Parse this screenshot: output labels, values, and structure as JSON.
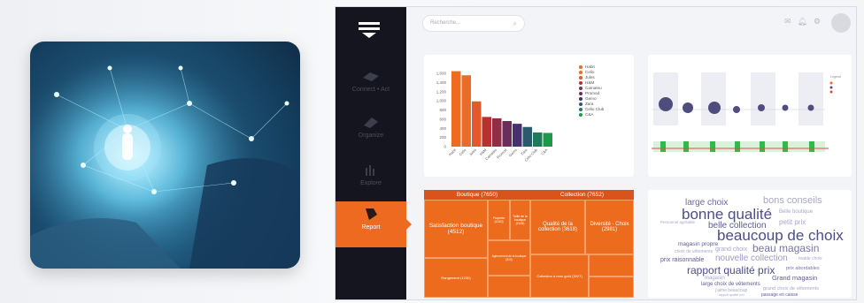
{
  "colors": {
    "accent": "#ee6a20",
    "sidebar": "#15151f",
    "word_dark": "#4a4a8a",
    "word_light": "#9b9bc4"
  },
  "sidebar": {
    "items": [
      {
        "label": "Connect • Act",
        "icon": "connect-icon",
        "active": false
      },
      {
        "label": "Organize",
        "icon": "organize-icon",
        "active": false
      },
      {
        "label": "Explore",
        "icon": "explore-icon",
        "active": false
      },
      {
        "label": "Report",
        "icon": "report-icon",
        "active": true
      }
    ]
  },
  "search": {
    "placeholder": "Recherche..."
  },
  "bar_chart": {
    "chart_data": {
      "type": "bar",
      "categories": [
        "Habit",
        "Celio",
        "Jules",
        "H&M",
        "Camaïeu",
        "Promod",
        "Gemo",
        "Zara",
        "Celio Club",
        "C&A"
      ],
      "values": [
        1650,
        1560,
        990,
        650,
        620,
        560,
        500,
        430,
        310,
        300
      ],
      "ylim": [
        0,
        1700
      ],
      "yticks": [
        "0",
        "200",
        "400",
        "600",
        "800",
        "1,000",
        "1,200",
        "1,400",
        "1,600"
      ],
      "colors": [
        "#ef6b1e",
        "#ec6b25",
        "#e35a28",
        "#b7312f",
        "#8f2e47",
        "#6b2d5c",
        "#47306e",
        "#2b5a6f",
        "#237a5b",
        "#1d9a49"
      ],
      "legend": [
        "Habit",
        "Celio",
        "Jules",
        "H&M",
        "Camaïeu",
        "Promod",
        "Gemo",
        "Zara",
        "Celio Club",
        "C&A"
      ]
    }
  },
  "treemap": {
    "headers": [
      "Boutique (7650)",
      "Collection (7652)"
    ],
    "cells": [
      "Satisfaction boutique (4512)",
      "Proprete (1330)",
      "Taille de la boutique (1105)",
      "Qualité de la collection (3618)",
      "Diversité - Choix (2981)",
      "Rangement (1230)",
      "Agencement de la boutique (813)",
      "Collection à mon goût (2027)"
    ]
  },
  "wordcloud": {
    "words": [
      "large choix",
      "bons conseils",
      "bonne qualité",
      "Belle boutique",
      "belle collection",
      "petit prix",
      "Personnel agréable",
      "beaucoup de choix",
      "magasin propre",
      "grand choix",
      "beau magasin",
      "choix de vêtements",
      "prix raisonnable",
      "nouvelle collection",
      "malde choix",
      "rapport qualité prix",
      "prix abordables",
      "magasin",
      "Grand magasin",
      "large choix de vêtements",
      "j'aime beaucoup",
      "grand choix de vêtements",
      "rapport qualité prix",
      "passage en caisse"
    ]
  }
}
